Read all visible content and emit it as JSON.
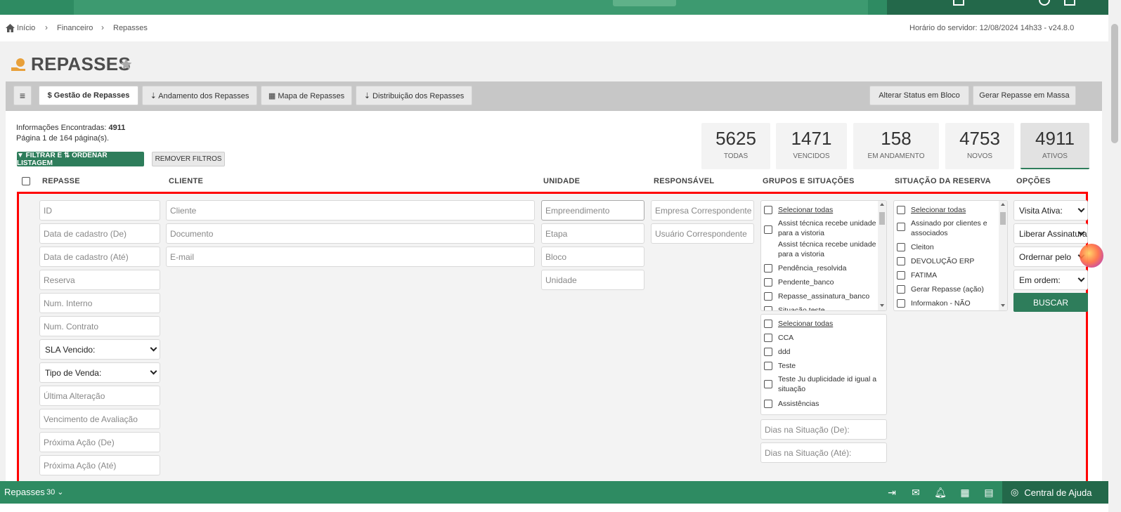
{
  "breadcrumb": {
    "home": "Início",
    "financeiro": "Financeiro",
    "repasses": "Repasses",
    "server_time": "Horário do servidor: 12/08/2024 14h33 - v24.8.0"
  },
  "page": {
    "title": "REPASSES"
  },
  "toolbar": {
    "menu_icon": "≡",
    "tabs": [
      "$ Gestão de Repasses",
      "⇣ Andamento dos Repasses",
      "▦ Mapa de Repasses",
      "⇣ Distribuição dos Repasses"
    ],
    "right": [
      "Alterar Status em Bloco",
      "Gerar Repasse em Massa"
    ]
  },
  "info": {
    "found_label": "Informações Encontradas:",
    "found_value": "4911",
    "page_line": "Página 1 de 164 página(s)."
  },
  "buttons": {
    "filter": "▼ FILTRAR E ⇅ ORDENAR LISTAGEM",
    "remove": "REMOVER FILTROS",
    "search": "BUSCAR"
  },
  "stats": [
    {
      "num": "5625",
      "label": "TODAS"
    },
    {
      "num": "1471",
      "label": "VENCIDOS"
    },
    {
      "num": "158",
      "label": "EM ANDAMENTO"
    },
    {
      "num": "4753",
      "label": "NOVOS"
    },
    {
      "num": "4911",
      "label": "ATIVOS"
    }
  ],
  "columns": {
    "repasse": "REPASSE",
    "cliente": "CLIENTE",
    "unidade": "UNIDADE",
    "responsavel": "RESPONSÁVEL",
    "grupos": "GRUPOS E SITUAÇÕES",
    "situacao": "SITUAÇÃO DA RESERVA",
    "opcoes": "OPÇÕES"
  },
  "repasse_fields": [
    "ID",
    "Data de cadastro (De)",
    "Data de cadastro (Até)",
    "Reserva",
    "Num. Interno",
    "Num. Contrato",
    "SLA Vencido:",
    "Tipo de Venda:",
    "Última Alteração",
    "Vencimento de Avaliação",
    "Próxima Ação (De)",
    "Próxima Ação (Até)"
  ],
  "cliente_fields": [
    "Cliente",
    "Documento",
    "E-mail"
  ],
  "unidade_fields": [
    "Empreendimento",
    "Etapa",
    "Bloco",
    "Unidade"
  ],
  "responsavel_fields": [
    "Empresa Correspondente",
    "Usuário Correspondente"
  ],
  "grupos_list": [
    "Selecionar todas",
    "Assist técnica recebe unidade para a vistoria",
    "Assist técnica recebe unidade para a vistoria",
    "Pendência_resolvida",
    "Pendente_banco",
    "Repasse_assinatura_banco",
    "Situação teste"
  ],
  "grupos_list2": [
    "Selecionar todas",
    "CCA",
    "ddd",
    "Teste",
    "Teste Ju duplicidade id igual a situação",
    "Assistências"
  ],
  "dias": [
    "Dias na Situação (De):",
    "Dias na Situação (Até):"
  ],
  "situacao_list": [
    "Selecionar todas",
    "Assinado por clientes e associados",
    "Cleiton",
    "DEVOLUÇÃO ERP",
    "FATIMA",
    "Gerar Repasse (ação)",
    "Informakon - NÃO"
  ],
  "opcoes": [
    "Visita Ativa:",
    "Liberar Assinatura",
    "Ordernar pelo",
    "Em ordem:"
  ],
  "bottom": {
    "label": "Repasses",
    "count": "30 ⌄",
    "help": "Central de Ajuda"
  },
  "colors": {
    "green": "#2e8b62",
    "dark_green": "#23684a",
    "accent": "#2e7d5b",
    "highlight_border": "#ff0000"
  }
}
